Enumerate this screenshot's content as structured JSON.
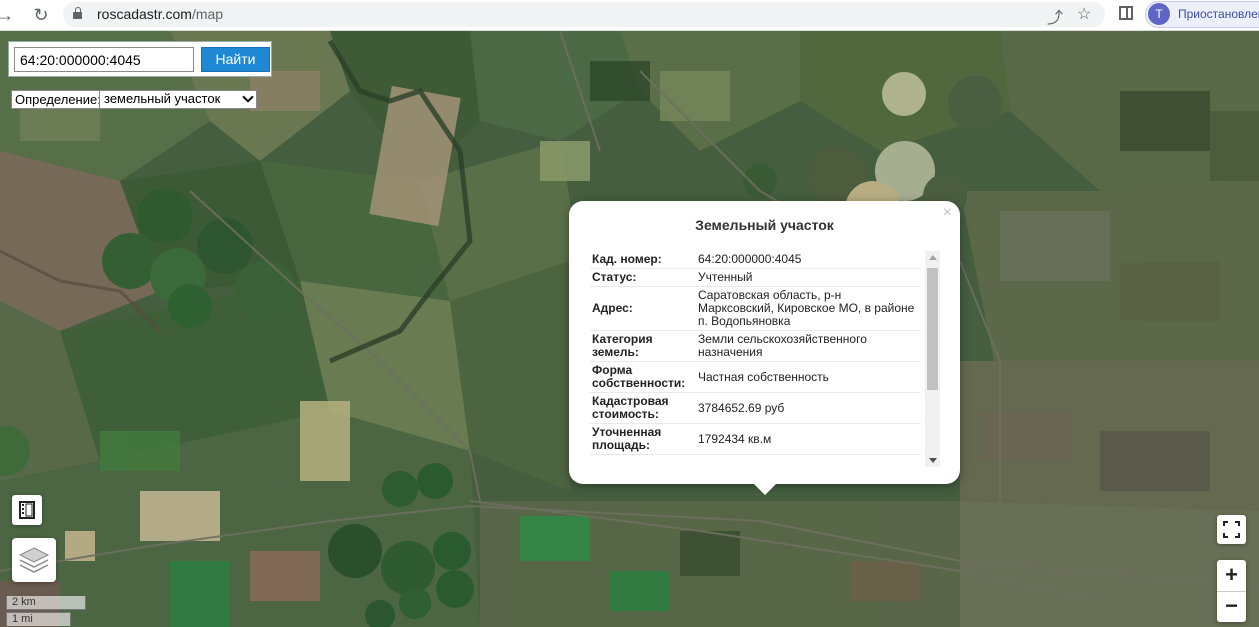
{
  "browser": {
    "url_domain": "roscadastr.com",
    "url_path": "/map",
    "profile_initial": "T",
    "profile_label": "Приостановлен"
  },
  "search": {
    "value": "64:20:000000:4045",
    "button_label": "Найти"
  },
  "definition": {
    "label": "Определение:",
    "selected": "земельный участок"
  },
  "popup": {
    "title": "Земельный участок",
    "rows": [
      {
        "key": "Кад. номер:",
        "value": "64:20:000000:4045"
      },
      {
        "key": "Статус:",
        "value": "Учтенный"
      },
      {
        "key": "Адрес:",
        "value": "Саратовская область, р-н Марксовский, Кировское МО, в районе п. Водопьяновка"
      },
      {
        "key": "Категория земель:",
        "value": "Земли сельскохозяйственного назначения"
      },
      {
        "key": "Форма собственности:",
        "value": "Частная собственность"
      },
      {
        "key": "Кадастровая стоимость:",
        "value": "3784652.69 руб"
      },
      {
        "key": "Уточненная площадь:",
        "value": "1792434 кв.м"
      }
    ]
  },
  "controls": {
    "zoom_in": "+",
    "zoom_out": "−",
    "close": "×"
  },
  "scale": {
    "km": "2 km",
    "mi": "1 mi"
  },
  "icons": [
    "back-arrow-icon",
    "reload-icon",
    "lock-icon",
    "share-icon",
    "bookmark-star-icon",
    "side-panel-icon",
    "filmstrip-icon",
    "layers-icon",
    "fullscreen-icon"
  ]
}
